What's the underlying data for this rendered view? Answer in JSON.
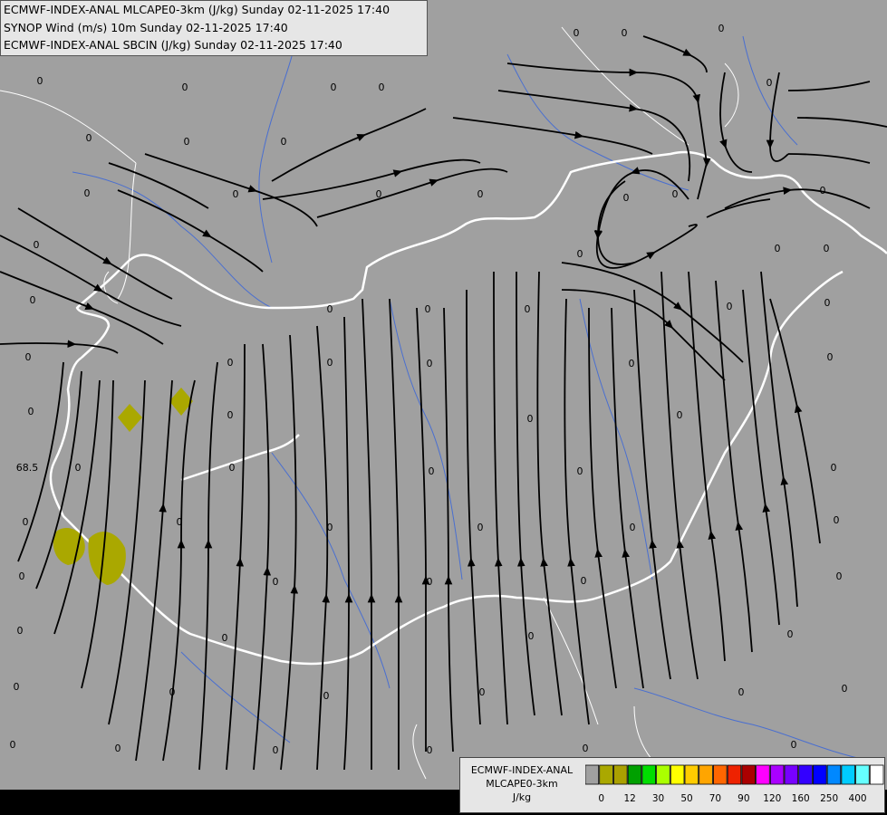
{
  "header": {
    "lines": [
      "ECMWF-INDEX-ANAL MLCAPE0-3km (J/kg) Sunday 02-11-2025 17:40",
      "SYNOP Wind (m/s) 10m Sunday 02-11-2025 17:40",
      "ECMWF-INDEX-ANAL SBCIN (J/kg) Sunday 02-11-2025 17:40"
    ]
  },
  "legend": {
    "name_lines": [
      "ECMWF-INDEX-ANAL",
      "MLCAPE0-3km",
      "J/kg"
    ],
    "colors": [
      "#a0a0a0",
      "#aaa800",
      "#aaa000",
      "#00a000",
      "#00dd00",
      "#aaff00",
      "#ffff00",
      "#ffcc00",
      "#ffa500",
      "#ff6600",
      "#ee2200",
      "#aa0000",
      "#ff00ff",
      "#aa00ff",
      "#7700ff",
      "#3300ff",
      "#0000ff",
      "#0088ff",
      "#00ccff",
      "#66ffff",
      "#ffffff"
    ],
    "ticks": [
      "0",
      "12",
      "30",
      "50",
      "70",
      "90",
      "120",
      "160",
      "250",
      "400"
    ]
  },
  "map": {
    "background": "#a0a0a0",
    "border_color": "#ffffff",
    "river_color": "#4a6fd0",
    "cape_color": "#aaa800",
    "zero_label": "0",
    "special_label": "68.5"
  }
}
